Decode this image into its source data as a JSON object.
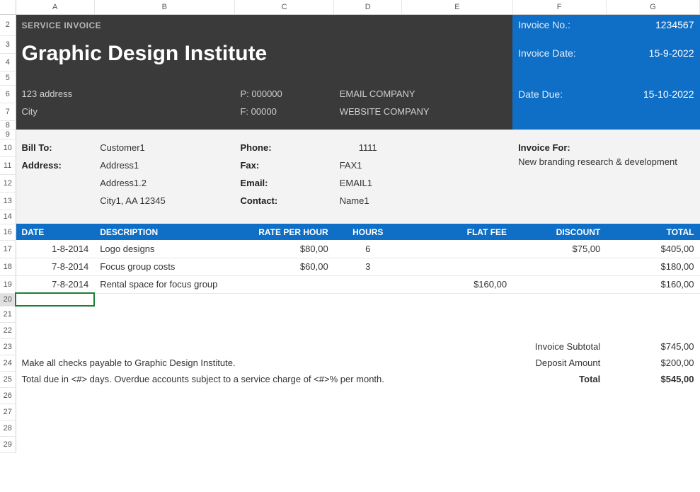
{
  "columns": [
    "A",
    "B",
    "C",
    "D",
    "E",
    "F",
    "G"
  ],
  "rows": [
    "2",
    "3",
    "4",
    "5",
    "6",
    "7",
    "8",
    "9",
    "10",
    "11",
    "12",
    "13",
    "14",
    "16",
    "17",
    "18",
    "19",
    "20",
    "21",
    "22",
    "23",
    "24",
    "25",
    "26",
    "27",
    "28",
    "29"
  ],
  "header": {
    "subtitle": "SERVICE INVOICE",
    "title": "Graphic Design Institute",
    "address_line1": "123 address",
    "address_line2": "City",
    "phone": "P: 000000",
    "fax": "F: 00000",
    "email_company": "EMAIL COMPANY",
    "website_company": "WEBSITE COMPANY"
  },
  "invoice": {
    "no_label": "Invoice No.:",
    "no_value": "1234567",
    "date_label": "Invoice Date:",
    "date_value": "15-9-2022",
    "due_label": "Date Due:",
    "due_value": "15-10-2022"
  },
  "bill": {
    "billto_label": "Bill To:",
    "billto_value": "Customer1",
    "address_label": "Address:",
    "address1": "Address1",
    "address2": "Address1.2",
    "address3": "City1, AA 12345",
    "phone_label": "Phone:",
    "phone_value": "1111",
    "fax_label": "Fax:",
    "fax_value": "FAX1",
    "email_label": "Email:",
    "email_value": "EMAIL1",
    "contact_label": "Contact:",
    "contact_value": "Name1",
    "invoicefor_label": "Invoice For:",
    "invoicefor_value": "New branding research & development"
  },
  "table": {
    "headers": {
      "date": "DATE",
      "description": "DESCRIPTION",
      "rate": "RATE PER HOUR",
      "hours": "HOURS",
      "flatfee": "FLAT FEE",
      "discount": "DISCOUNT",
      "total": "TOTAL"
    },
    "rows": [
      {
        "date": "1-8-2014",
        "desc": "Logo designs",
        "rate": "$80,00",
        "hours": "6",
        "flatfee": "",
        "discount": "$75,00",
        "total": "$405,00"
      },
      {
        "date": "7-8-2014",
        "desc": "Focus group costs",
        "rate": "$60,00",
        "hours": "3",
        "flatfee": "",
        "discount": "",
        "total": "$180,00"
      },
      {
        "date": "7-8-2014",
        "desc": "Rental space for focus group",
        "rate": "",
        "hours": "",
        "flatfee": "$160,00",
        "discount": "",
        "total": "$160,00"
      }
    ]
  },
  "footer": {
    "checks_line": "Make all checks payable to Graphic Design Institute.",
    "terms_line": "Total due in <#> days. Overdue accounts subject to a service charge of <#>% per month.",
    "subtotal_label": "Invoice Subtotal",
    "subtotal_value": "$745,00",
    "deposit_label": "Deposit Amount",
    "deposit_value": "$200,00",
    "total_label": "Total",
    "total_value": "$545,00"
  }
}
